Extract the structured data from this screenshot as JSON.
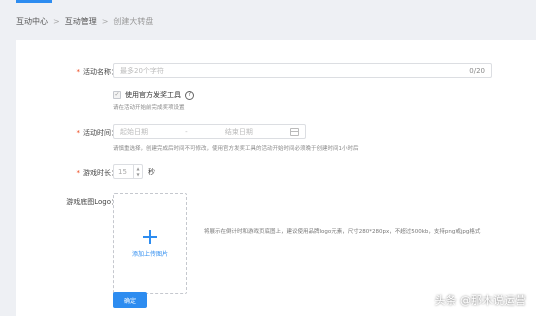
{
  "breadcrumb": {
    "items": [
      "互动中心",
      "互动管理",
      "创建大转盘"
    ]
  },
  "form": {
    "activity_name": {
      "label": "活动名称：",
      "placeholder": "最多20个字符",
      "counter": "0/20"
    },
    "official_tool": {
      "label": "使用官方发奖工具",
      "checked": true,
      "hint": "请在活动开始前完成奖项设置"
    },
    "activity_time": {
      "label": "活动时间：",
      "start_placeholder": "起始日期",
      "separator": "-",
      "end_placeholder": "结束日期",
      "hint": "请慎重选择，创建完成后时间不可修改，使用官方发奖工具的活动开始时间必须晚于创建时间1小时后"
    },
    "game_duration": {
      "label": "游戏时长：",
      "value": "15",
      "unit": "秒"
    },
    "game_logo": {
      "label": "游戏底图Logo：",
      "upload_text": "添加上传图片",
      "description": "将展示在倒计时和游戏页底图上，建议使用品牌logo元素，尺寸280*280px，不超过500kb，支持png或jpg格式"
    },
    "confirm_label": "确定"
  },
  "watermark": "头条 @那木说运营",
  "colors": {
    "accent": "#2d8cf0",
    "required": "#ed4014",
    "background": "#eef0f4"
  }
}
